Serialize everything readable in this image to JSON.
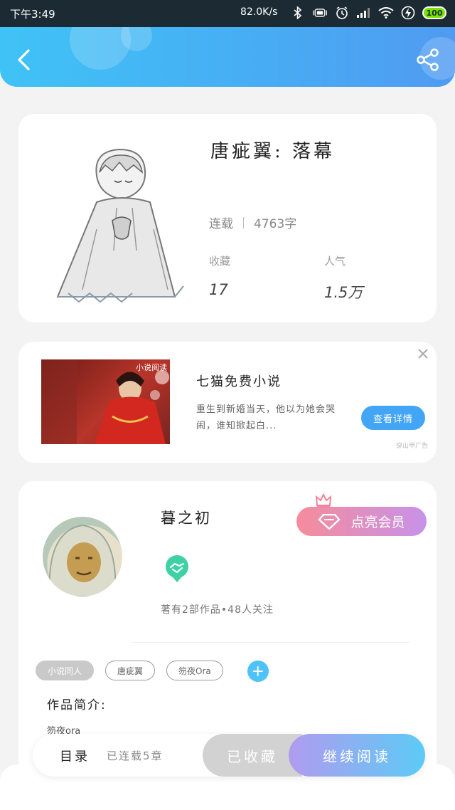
{
  "status_bar": {
    "time": "下午3:49",
    "network_speed": "82.0K/s",
    "battery": "100",
    "icons": [
      "bluetooth-icon",
      "vibrate-icon",
      "alarm-icon",
      "signal-icon",
      "wifi-icon",
      "charging-icon",
      "battery-icon"
    ]
  },
  "header": {
    "back_icon": "chevron-left-icon",
    "share_icon": "share-icon",
    "gradient": [
      "#3fc3f6",
      "#4f9bf2"
    ]
  },
  "book": {
    "title": "唐疵翼: 落幕",
    "status": "连载",
    "word_count": "4763字",
    "favorites_label": "收藏",
    "favorites_value": "17",
    "popularity_label": "人气",
    "popularity_value": "1.5万"
  },
  "ad": {
    "image_tag": "小说阅读",
    "title": "七猫免费小说",
    "description": "重生到新婚当天，他以为她会哭闹，谁知掀起白...",
    "button_label": "查看详情",
    "source": "穿山甲广告"
  },
  "author": {
    "name": "暮之初",
    "vip_label": "点亮会员",
    "stats": "著有2部作品•48人关注",
    "tags": [
      "小说同人",
      "唐疵翼",
      "笏夜Ora"
    ],
    "intro_label": "作品简介:",
    "intro_text": "笏夜ora"
  },
  "bottom_bar": {
    "toc_label": "目录",
    "chapters": "已连载5章",
    "favorited_label": "已收藏",
    "continue_label": "继续阅读"
  },
  "colors": {
    "accent_blue": "#42a5f5",
    "vip_gradient": [
      "#f58c9b",
      "#c792e9"
    ],
    "read_gradient": [
      "#b19bef",
      "#5ccbf6"
    ]
  }
}
